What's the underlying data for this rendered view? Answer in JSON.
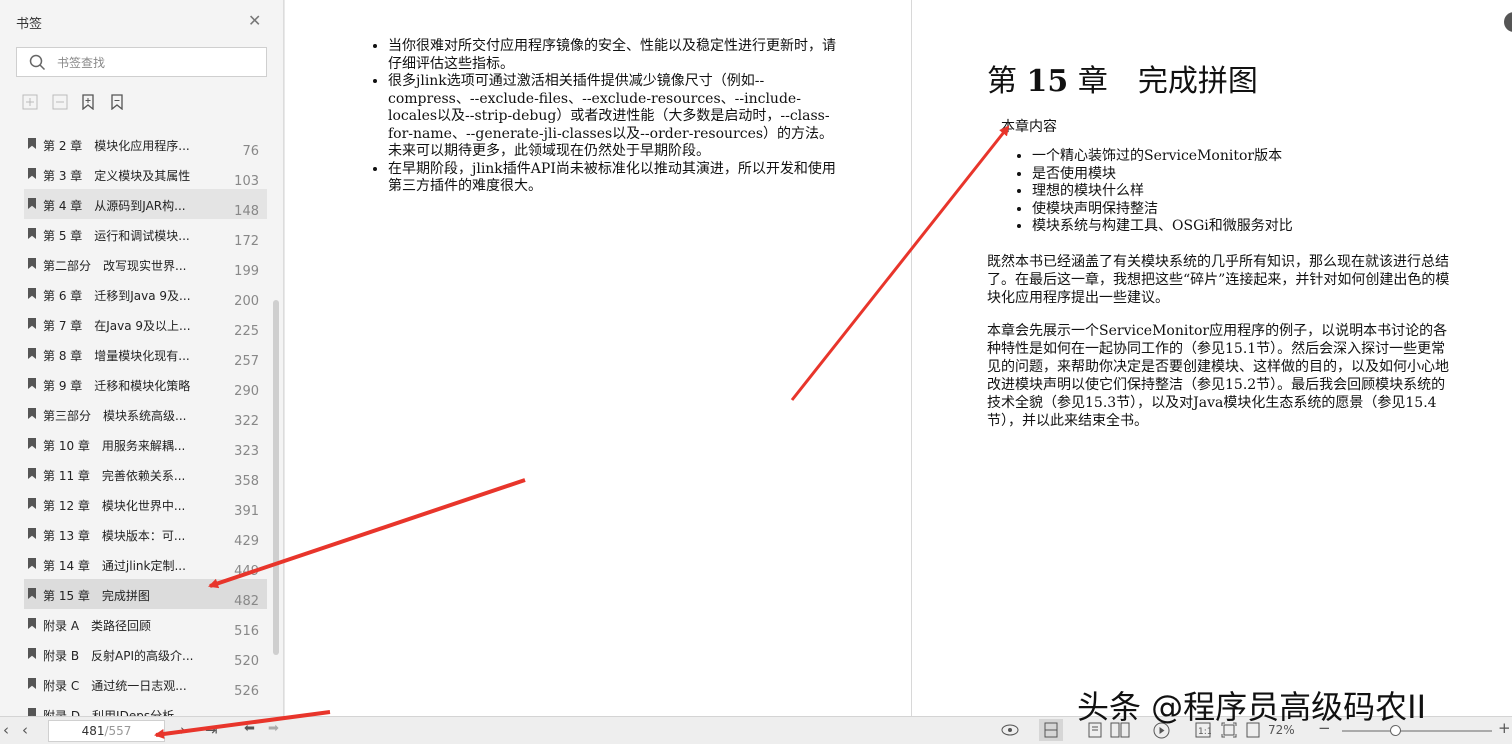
{
  "sidebar": {
    "title": "书签",
    "search_placeholder": "书签查找",
    "items": [
      {
        "label": "第 2 章　模块化应用程序...",
        "page": "76"
      },
      {
        "label": "第 3 章　定义模块及其属性",
        "page": "103"
      },
      {
        "label": "第 4 章　从源码到JAR构...",
        "page": "148"
      },
      {
        "label": "第 5 章　运行和调试模块...",
        "page": "172"
      },
      {
        "label": "第二部分　改写现实世界...",
        "page": "199"
      },
      {
        "label": "第 6 章　迁移到Java 9及...",
        "page": "200"
      },
      {
        "label": "第 7 章　在Java 9及以上...",
        "page": "225"
      },
      {
        "label": "第 8 章　增量模块化现有...",
        "page": "257"
      },
      {
        "label": "第 9 章　迁移和模块化策略",
        "page": "290"
      },
      {
        "label": "第三部分　模块系统高级...",
        "page": "322"
      },
      {
        "label": "第 10 章　用服务来解耦...",
        "page": "323"
      },
      {
        "label": "第 11 章　完善依赖关系...",
        "page": "358"
      },
      {
        "label": "第 12 章　模块化世界中...",
        "page": "391"
      },
      {
        "label": "第 13 章　模块版本：可...",
        "page": "429"
      },
      {
        "label": "第 14 章　通过jlink定制...",
        "page": "449"
      },
      {
        "label": "第 15 章　完成拼图",
        "page": "482"
      },
      {
        "label": "附录 A　类路径回顾",
        "page": "516"
      },
      {
        "label": "附录 B　反射API的高级介...",
        "page": "520"
      },
      {
        "label": "附录 C　通过统一日志观...",
        "page": "526"
      },
      {
        "label": "附录 D　利用JDeps分析...",
        "page": ""
      }
    ],
    "selected_index": 15,
    "hover_index": 2
  },
  "doc": {
    "left_bullets": [
      "当你很难对所交付应用程序镜像的安全、性能以及稳定性进行更新时，请仔细评估这些指标。",
      "很多jlink选项可通过激活相关插件提供减少镜像尺寸（例如--compress、--exclude-files、--exclude-resources、--include-locales以及--strip-debug）或者改进性能（大多数是启动时，--class-for-name、--generate-jli-classes以及--order-resources）的方法。未来可以期待更多，此领域现在仍然处于早期阶段。",
      "在早期阶段，jlink插件API尚未被标准化以推动其演进，所以开发和使用第三方插件的难度很大。"
    ],
    "chapter_prefix": "第",
    "chapter_number": "15",
    "chapter_suffix": "章",
    "chapter_name": "完成拼图",
    "section_heading": "本章内容",
    "topics": [
      "一个精心装饰过的ServiceMonitor版本",
      "是否使用模块",
      "理想的模块什么样",
      "使模块声明保持整洁",
      "模块系统与构建工具、OSGi和微服务对比"
    ],
    "para1": "既然本书已经涵盖了有关模块系统的几乎所有知识，那么现在就该进行总结了。在最后这一章，我想把这些“碎片”连接起来，并针对如何创建出色的模块化应用程序提出一些建议。",
    "para2": "本章会先展示一个ServiceMonitor应用程序的例子，以说明本书讨论的各种特性是如何在一起协同工作的（参见15.1节）。然后会深入探讨一些更常见的问题，来帮助你决定是否要创建模块、这样做的目的，以及如何小心地改进模块声明以使它们保持整洁（参见15.2节）。最后我会回顾模块系统的技术全貌（参见15.3节），以及对Java模块化生态系统的愿景（参见15.4节），并以此来结束全书。"
  },
  "bottombar": {
    "current_page": "481",
    "total_pages": "/557",
    "zoom": "72%",
    "zoom_level": 0.35
  },
  "watermark": "头条 @程序员高级码农II",
  "colors": {
    "arrow": "#e8352b",
    "selected_bg": "#dcdcdc"
  }
}
